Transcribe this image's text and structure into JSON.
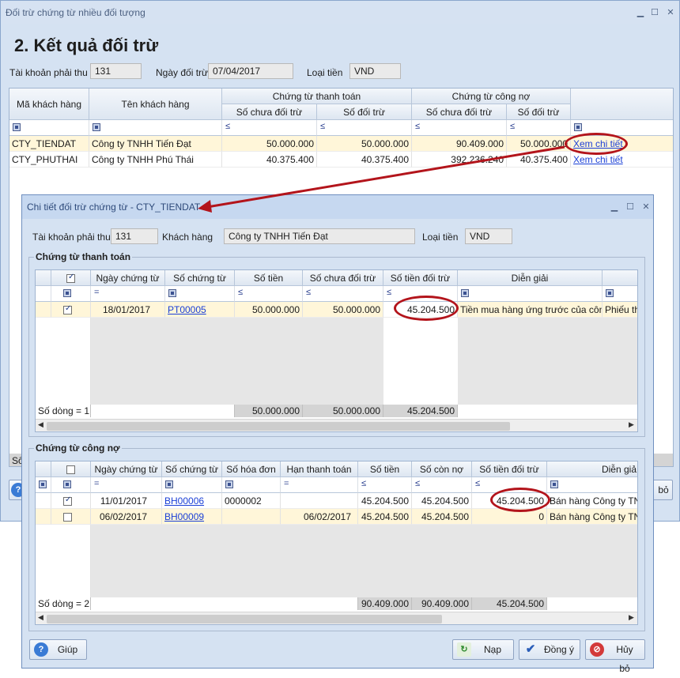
{
  "main": {
    "title": "Đối trừ chứng từ nhiều đối tượng",
    "heading": "2. Kết quả đối trừ",
    "account_label": "Tài khoản phải thu",
    "account_value": "131",
    "date_label": "Ngày đối trừ",
    "date_value": "07/04/2017",
    "currency_label": "Loại tiền",
    "currency_value": "VND",
    "headers": {
      "customer_code": "Mã khách hàng",
      "customer_name": "Tên khách hàng",
      "payment_group": "Chứng từ thanh toán",
      "debt_group": "Chứng từ công nợ",
      "unmatched": "Số chưa đối trừ",
      "matched": "Số đối trừ"
    },
    "filter_le": "≤",
    "rows": [
      {
        "code": "CTY_TIENDAT",
        "name": "Công ty TNHH Tiến Đạt",
        "pay_unmatched": "50.000.000",
        "pay_matched": "50.000.000",
        "debt_unmatched": "90.409.000",
        "debt_matched": "50.000.000",
        "link": "Xem chi tiết"
      },
      {
        "code": "CTY_PHUTHAI",
        "name": "Công ty TNHH Phú Thái",
        "pay_unmatched": "40.375.400",
        "pay_matched": "40.375.400",
        "debt_unmatched": "392.236.240",
        "debt_matched": "40.375.400",
        "link": "Xem chi tiết"
      }
    ],
    "footer_partial": "Số",
    "bottom_button_partial": "bỏ"
  },
  "detail": {
    "title": "Chi tiết đối trừ chứng từ - CTY_TIENDAT",
    "account_label": "Tài khoản phải thu",
    "account_value": "131",
    "customer_label": "Khách hàng",
    "customer_value": "Công ty TNHH Tiến Đạt",
    "currency_label": "Loại tiền",
    "currency_value": "VND",
    "payment_section": {
      "title": "Chứng từ thanh toán",
      "headers": [
        "Ngày chứng từ",
        "Số chứng từ",
        "Số tiền",
        "Số chưa đối trừ",
        "Số tiền đối trừ",
        "Diễn giải"
      ],
      "filter_eq": "=",
      "filter_le": "≤",
      "rows": [
        {
          "date": "18/01/2017",
          "voucher": "PT00005",
          "amount": "50.000.000",
          "unmatched": "50.000.000",
          "matched": "45.204.500",
          "desc": "Tiền mua hàng ứng trước của côn...",
          "desc2": "Phiếu th"
        }
      ],
      "footer": {
        "count": "Số dòng = 1",
        "amount": "50.000.000",
        "unmatched": "50.000.000",
        "matched": "45.204.500"
      }
    },
    "debt_section": {
      "title": "Chứng từ công nợ",
      "headers": [
        "Ngày chứng từ",
        "Số chứng từ",
        "Số hóa đơn",
        "Hạn thanh toán",
        "Số tiền",
        "Số còn nợ",
        "Số tiền đối trừ",
        "Diễn giả"
      ],
      "filter_eq": "=",
      "filter_le": "≤",
      "rows": [
        {
          "date": "11/01/2017",
          "voucher": "BH00006",
          "invoice": "0000002",
          "due": "",
          "amount": "45.204.500",
          "remaining": "45.204.500",
          "matched": "45.204.500",
          "desc": "Bán hàng Công ty TNH",
          "checked": true
        },
        {
          "date": "06/02/2017",
          "voucher": "BH00009",
          "invoice": "",
          "due": "06/02/2017",
          "amount": "45.204.500",
          "remaining": "45.204.500",
          "matched": "0",
          "desc": "Bán hàng Công ty TNH",
          "checked": false
        }
      ],
      "footer": {
        "count": "Số dòng = 2",
        "amount": "90.409.000",
        "remaining": "90.409.000",
        "matched": "45.204.500"
      }
    },
    "buttons": {
      "help": "Giúp",
      "load": "Nạp",
      "ok": "Đồng ý",
      "cancel": "Hủy bỏ"
    }
  },
  "colors": {
    "annotation": "#b3141b",
    "link": "#1a3fd6",
    "selected_row": "#fff6d9",
    "window": "#d5e2f2"
  }
}
